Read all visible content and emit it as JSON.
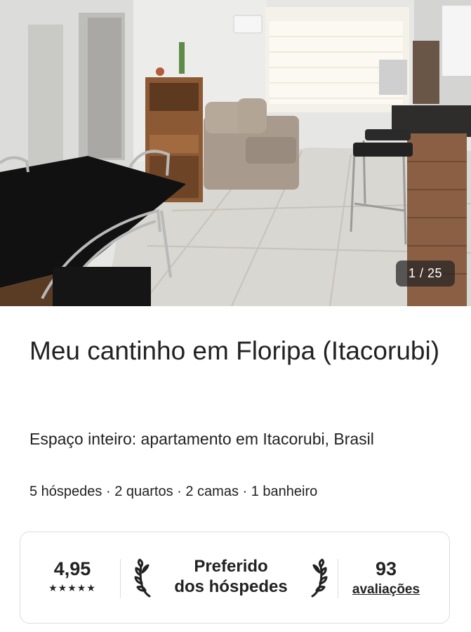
{
  "listing": {
    "photo_counter": "1 / 25",
    "title": "Meu cantinho em Floripa (Itacorubi)",
    "subtitle": "Espaço inteiro: apartamento em Itacorubi, Brasil",
    "details": "5 hóspedes · 2 quartos · 2 camas · 1 banheiro"
  },
  "rating_card": {
    "rating": "4,95",
    "stars": "★★★★★",
    "badge_line1": "Preferido",
    "badge_line2": "dos hóspedes",
    "reviews_count": "93",
    "reviews_label": "avaliações"
  },
  "colors": {
    "text": "#222222",
    "border": "#dddddd",
    "counter_bg": "#222222"
  }
}
